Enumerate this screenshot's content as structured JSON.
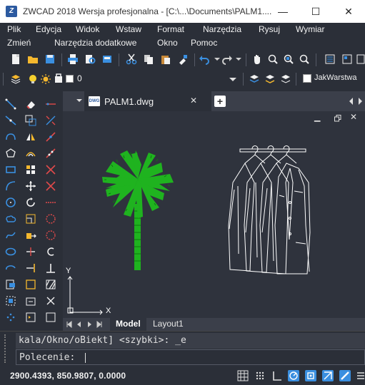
{
  "window": {
    "title": "ZWCAD 2018 Wersja profesjonalna - [C:\\...\\Documents\\PALM1....",
    "minimize": "—",
    "maximize": "☐",
    "close": "✕"
  },
  "menu1": [
    "Plik",
    "Edycja",
    "Widok",
    "Wstaw",
    "Format",
    "Narzędzia",
    "Rysuj",
    "Wymiar"
  ],
  "menu2": [
    "Zmień",
    "Narzędzia dodatkowe",
    "Okno",
    "Pomoc"
  ],
  "layer_toolbar": {
    "current_layer": "0",
    "color_control": "JakWarstwa"
  },
  "document": {
    "tab_label": "PALM1.dwg",
    "tab_icon_text": "DWG",
    "close_symbol": "✕",
    "add_symbol": "+",
    "ucs_x": "X",
    "ucs_y": "Y"
  },
  "layout_tabs": [
    "Model",
    "Layout1"
  ],
  "command": {
    "history": "kala/Okno/oBiekt] <szybki>: _e",
    "prompt": "Polecenie:"
  },
  "status": {
    "coordinates": "2900.4393, 850.9807, 0.0000"
  },
  "colors": {
    "background": "#2b2f38",
    "canvas": "#2f333d",
    "palm": "#1fb31f",
    "accent_blue": "#3a8fe0"
  }
}
